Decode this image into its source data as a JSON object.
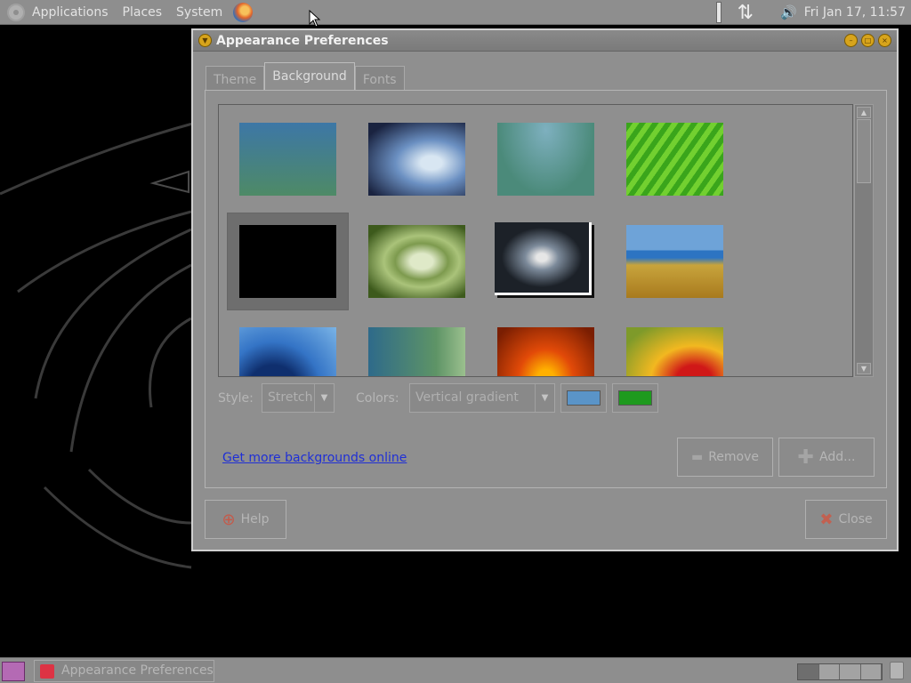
{
  "top_panel": {
    "menus": [
      "Applications",
      "Places",
      "System"
    ],
    "clock": "Fri Jan 17, 11:57"
  },
  "window": {
    "title": "Appearance Preferences",
    "tabs": [
      "Theme",
      "Background",
      "Fonts"
    ],
    "active_tab": "Background",
    "style_label": "Style:",
    "style_value": "Stretch",
    "colors_label": "Colors:",
    "colors_value": "Vertical gradient",
    "primary_color": "#5a94c8",
    "secondary_color": "#1e9a1e",
    "more_link": "Get more backgrounds online",
    "remove_label": "Remove",
    "add_label": "Add...",
    "help_label": "Help",
    "close_label": "Close"
  },
  "taskbar": {
    "task_label": "Appearance Preferences"
  },
  "colors": {
    "panel": "#8e8e8e",
    "window_bg": "#8f8f8f",
    "link": "#1f2fd6"
  }
}
